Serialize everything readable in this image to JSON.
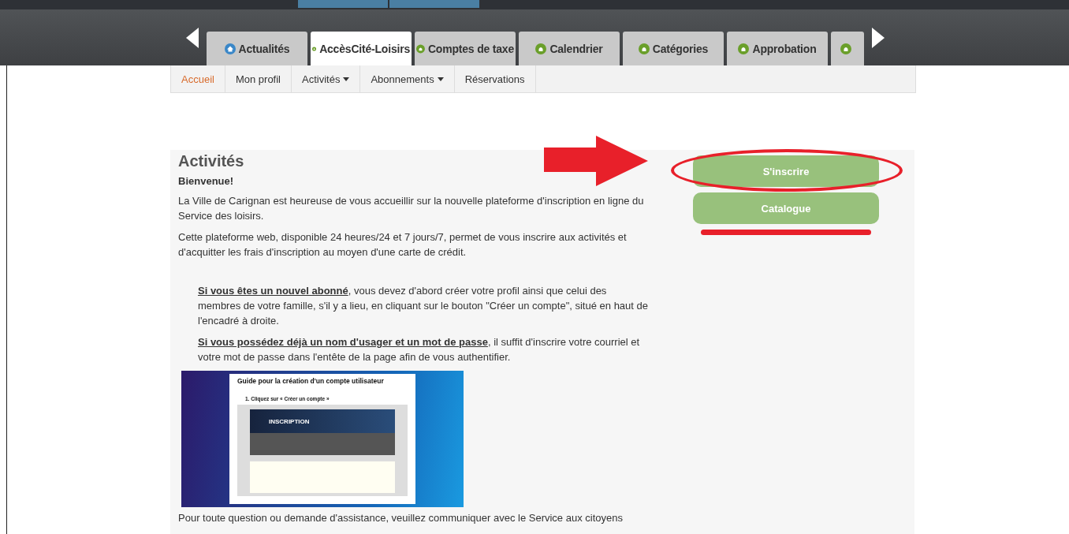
{
  "main_tabs": [
    {
      "label": "Actualités",
      "kind": "home",
      "selected": false
    },
    {
      "label": "AccèsCité-Loisirs",
      "kind": "module",
      "selected": true
    },
    {
      "label": "Comptes de taxe",
      "kind": "module",
      "selected": false
    },
    {
      "label": "Calendrier",
      "kind": "module",
      "selected": false
    },
    {
      "label": "Catégories",
      "kind": "module",
      "selected": false
    },
    {
      "label": "Approbation",
      "kind": "module",
      "selected": false
    },
    {
      "kind": "module",
      "selected": false
    }
  ],
  "sub_nav": [
    {
      "label": "Accueil",
      "dropdown": false,
      "selected": true
    },
    {
      "label": "Mon profil",
      "dropdown": false,
      "selected": false
    },
    {
      "label": "Activités",
      "dropdown": true,
      "selected": false
    },
    {
      "label": "Abonnements",
      "dropdown": true,
      "selected": false
    },
    {
      "label": "Réservations",
      "dropdown": false,
      "selected": false
    }
  ],
  "content": {
    "title": "Activités",
    "greeting": "Bienvenue!",
    "paragraphs": [
      "La Ville de Carignan est heureuse de vous accueillir sur la nouvelle plateforme d'inscription en ligne du Service des loisirs.",
      "Cette plateforme web, disponible 24 heures/24 et 7 jours/7, permet de vous inscrire aux activités et d'acquitter les frais d'inscription au moyen d'une carte de crédit."
    ],
    "notes": [
      {
        "lead": "Si vous êtes un nouvel abonné",
        "text": ", vous devez d'abord créer votre profil ainsi que celui des membres de votre famille, s'il y a lieu, en cliquant sur le bouton \"Créer un compte\", situé en haut de l'encadré à droite."
      },
      {
        "lead": "Si vous possédez déjà un nom d'usager et un mot de passe",
        "text": ", il suffit d'inscrire votre courriel et votre mot de passe dans l'entête de la page afin de vous authentifier."
      }
    ],
    "guide": {
      "title": "Guide pour la création d'un compte utilisateur",
      "step": "1.  Cliquez sur « Créer un compte »",
      "banner": "INSCRIPTION"
    },
    "footer_text": "Pour toute question ou demande d'assistance, veuillez communiquer avec le Service aux citoyens"
  },
  "actions": [
    {
      "label": "S'inscrire"
    },
    {
      "label": "Catalogue"
    }
  ]
}
